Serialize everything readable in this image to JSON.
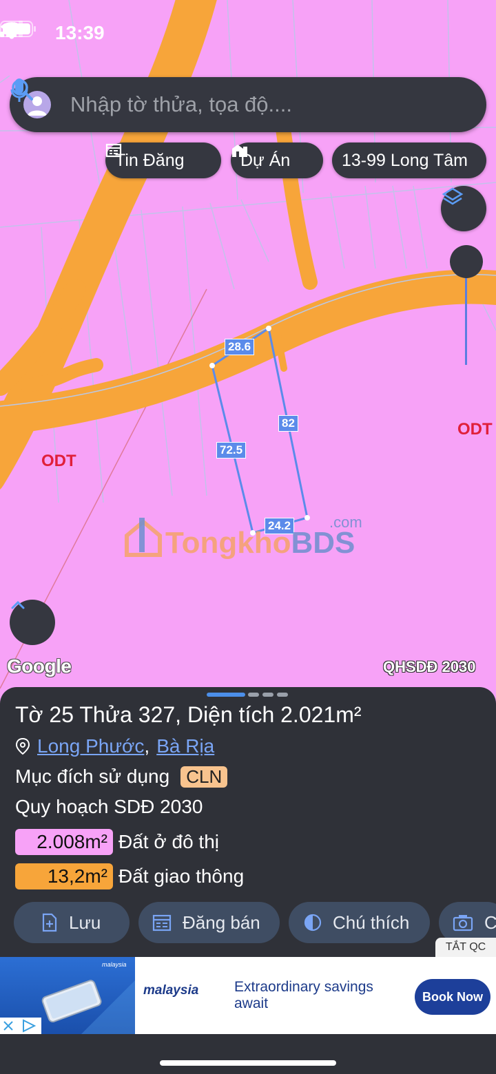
{
  "status_bar": {
    "time": "13:39"
  },
  "search": {
    "placeholder": "Nhập tờ thửa, tọa độ...."
  },
  "chips": [
    {
      "label": "Tin Đăng",
      "icon": "listing-icon"
    },
    {
      "label": "Dự Án",
      "icon": "building-icon"
    },
    {
      "label": "13-99 Long Tâm",
      "icon": ""
    }
  ],
  "map": {
    "zone_labels": [
      "ODT",
      "ODT"
    ],
    "edge_lengths": [
      "28.6",
      "82",
      "72.5",
      "24.2"
    ],
    "watermark": {
      "brand_a": "Tongkho",
      "brand_b": "BDS",
      "suffix": ".com"
    },
    "attribution": "Google",
    "layer_name": "QHSDĐ 2030",
    "colors": {
      "residential": "#f7a2f7",
      "road": "#f7a53a",
      "boundary": "#5b8bea",
      "zone_label": "#e0203a"
    }
  },
  "parcel": {
    "title": "Tờ 25 Thửa 327, Diện tích 2.021m²",
    "ward": "Long Phước",
    "separator": ",",
    "city": "Bà Rịa",
    "purpose_label": "Mục đích sử dụng",
    "purpose_code": "CLN",
    "planning_title": "Quy hoạch SDĐ 2030",
    "zones": [
      {
        "area": "2.008m²",
        "name": "Đất ở đô thị",
        "color": "#f7a2f7"
      },
      {
        "area": "13,2m²",
        "name": "Đất giao thông",
        "color": "#f7a53a"
      }
    ]
  },
  "actions": [
    {
      "label": "Lưu",
      "icon": "save-doc-icon"
    },
    {
      "label": "Đăng bán",
      "icon": "calendar-icon"
    },
    {
      "label": "Chú thích",
      "icon": "contrast-icon"
    },
    {
      "label": "C",
      "icon": "camera-icon"
    }
  ],
  "ad": {
    "close_label": "TẮT QC",
    "brand": "malaysia",
    "headline": "Extraordinary savings await",
    "cta": "Book Now",
    "image_caption": "malaysia"
  }
}
